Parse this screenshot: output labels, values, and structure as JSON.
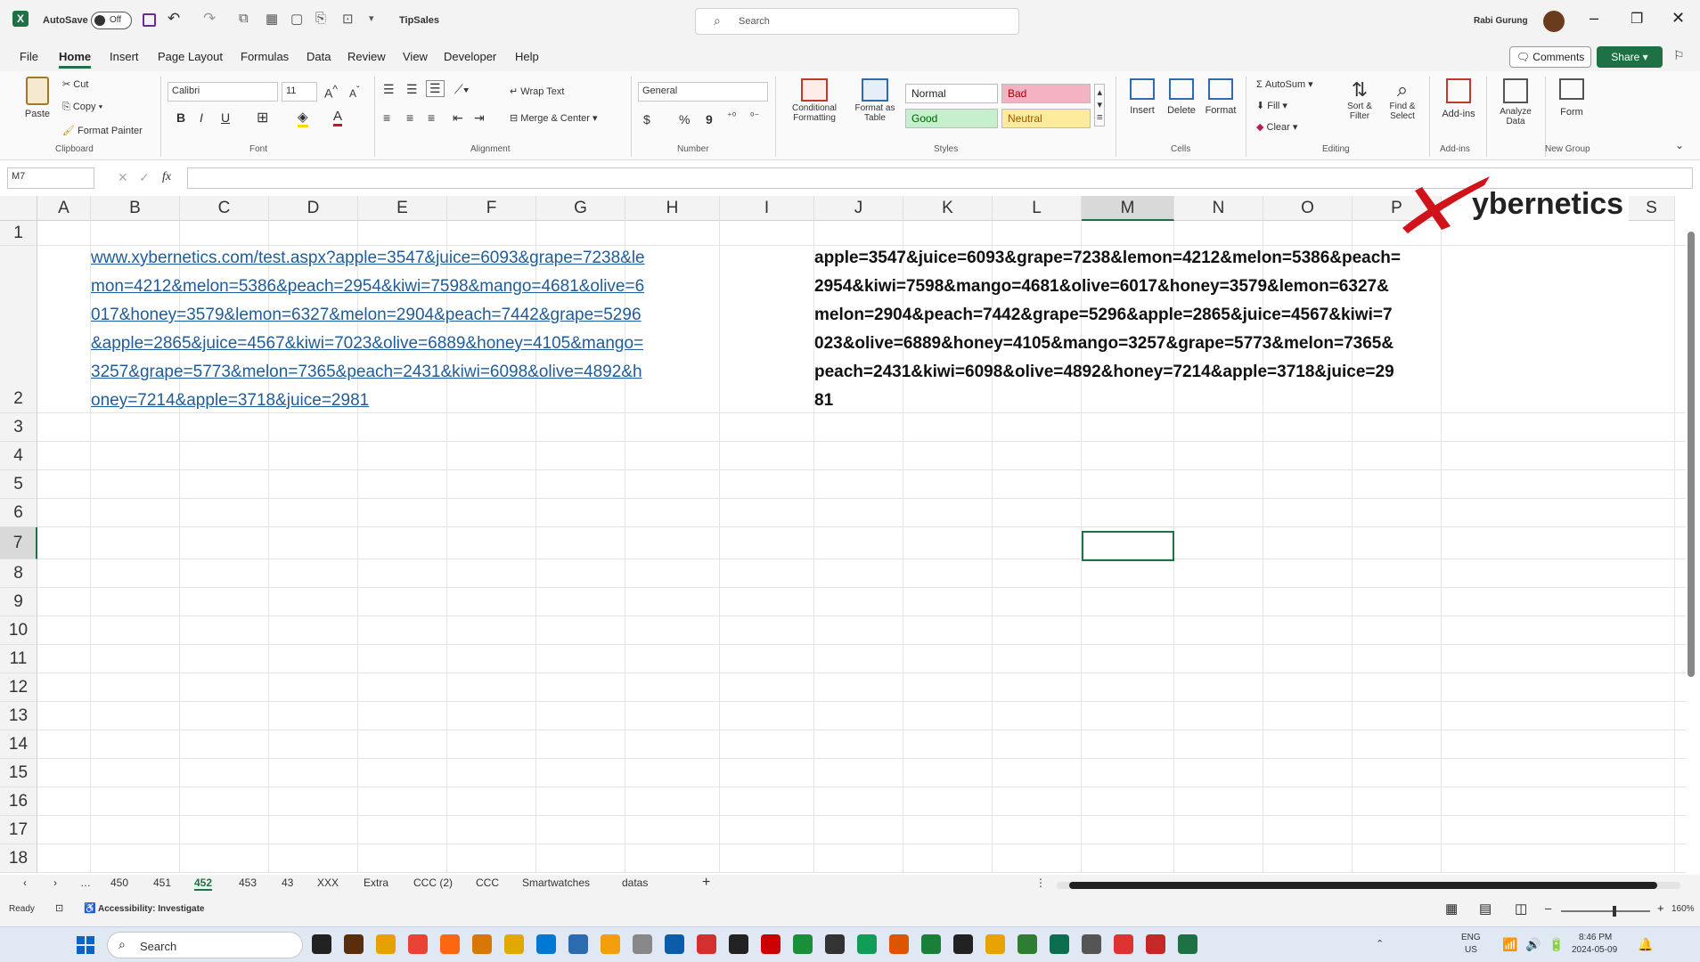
{
  "titlebar": {
    "autosave_label": "AutoSave",
    "autosave_state": "Off",
    "filename": "TipSales",
    "search_placeholder": "Search",
    "user_name": "Rabi Gurung"
  },
  "menubar": {
    "items": [
      "File",
      "Home",
      "Insert",
      "Page Layout",
      "Formulas",
      "Data",
      "Review",
      "View",
      "Developer",
      "Help"
    ],
    "active": "Home",
    "comments_label": "Comments",
    "share_label": "Share"
  },
  "ribbon": {
    "clipboard": {
      "paste": "Paste",
      "cut": "Cut",
      "copy": "Copy",
      "format_painter": "Format Painter",
      "label": "Clipboard"
    },
    "font": {
      "name": "Calibri",
      "size": "11",
      "label": "Font",
      "bold": "B",
      "italic": "I",
      "underline": "U"
    },
    "alignment": {
      "wrap_text": "Wrap Text",
      "merge_center": "Merge & Center",
      "label": "Alignment"
    },
    "number": {
      "format": "General",
      "currency": "$",
      "percent": "%",
      "comma": "9",
      "label": "Number"
    },
    "styles": {
      "conditional": "Conditional Formatting",
      "format_table": "Format as Table",
      "normal": "Normal",
      "bad": "Bad",
      "good": "Good",
      "neutral": "Neutral",
      "label": "Styles"
    },
    "cells": {
      "insert": "Insert",
      "delete": "Delete",
      "format": "Format",
      "label": "Cells"
    },
    "editing": {
      "autosum": "AutoSum",
      "fill": "Fill",
      "clear": "Clear",
      "sort_filter": "Sort & Filter",
      "find_select": "Find & Select",
      "label": "Editing"
    },
    "addins": {
      "addins": "Add-ins",
      "label": "Add-ins"
    },
    "analyze": {
      "label": "Analyze Data"
    },
    "form": {
      "label": "Form",
      "group": "New Group"
    }
  },
  "formulabar": {
    "name_box": "M7",
    "fx": "fx",
    "content": ""
  },
  "columns": [
    "A",
    "B",
    "C",
    "D",
    "E",
    "F",
    "G",
    "H",
    "I",
    "J",
    "K",
    "L",
    "M",
    "N",
    "O",
    "P",
    "S"
  ],
  "rows": [
    "1",
    "2",
    "3",
    "4",
    "5",
    "6",
    "7",
    "8",
    "9",
    "10",
    "11",
    "12",
    "13",
    "14",
    "15",
    "16",
    "17",
    "18"
  ],
  "cells": {
    "b2_lines": [
      "www.xybernetics.com/test.aspx?apple=3547&juice=6093&grape=7238&le",
      "mon=4212&melon=5386&peach=2954&kiwi=7598&mango=4681&olive=6",
      "017&honey=3579&lemon=6327&melon=2904&peach=7442&grape=5296",
      "&apple=2865&juice=4567&kiwi=7023&olive=6889&honey=4105&mango=",
      "3257&grape=5773&melon=7365&peach=2431&kiwi=6098&olive=4892&h",
      "oney=7214&apple=3718&juice=2981"
    ],
    "j2_lines": [
      "apple=3547&juice=6093&grape=7238&lemon=4212&melon=5386&peach=",
      "2954&kiwi=7598&mango=4681&olive=6017&honey=3579&lemon=6327&",
      "melon=2904&peach=7442&grape=5296&apple=2865&juice=4567&kiwi=7",
      "023&olive=6889&honey=4105&mango=3257&grape=5773&melon=7365&",
      "peach=2431&kiwi=6098&olive=4892&honey=7214&apple=3718&juice=29",
      "81"
    ]
  },
  "watermark": "ybernetics",
  "sheet_tabs": [
    "450",
    "451",
    "452",
    "453",
    "43",
    "XXX",
    "Extra",
    "CCC (2)",
    "CCC",
    "Smartwatches",
    "datas"
  ],
  "active_tab": "452",
  "statusbar": {
    "ready": "Ready",
    "accessibility": "Accessibility: Investigate",
    "zoom": "160%"
  },
  "taskbar": {
    "search": "Search",
    "lang": "ENG",
    "region": "US",
    "time": "8:46 PM",
    "date": "2024-05-09"
  },
  "colors": {
    "excel_green": "#1e7145",
    "link_blue": "#1f5c99",
    "watermark_red": "#d0121b"
  }
}
